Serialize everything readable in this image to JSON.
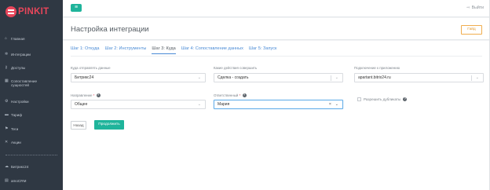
{
  "app": {
    "logo": "PINKIT"
  },
  "sidebar": {
    "items": [
      {
        "label": "Главная",
        "icon": "home-icon",
        "glyph": "⌂"
      },
      {
        "label": "Интеграции",
        "icon": "integrations-icon",
        "glyph": "✲"
      },
      {
        "label": "Доступы",
        "icon": "key-icon",
        "glyph": "⚷"
      },
      {
        "label": "Сопоставление сущностей",
        "icon": "mapping-icon",
        "glyph": "▦"
      },
      {
        "label": "Настройки",
        "icon": "settings-icon",
        "glyph": "⚙"
      },
      {
        "label": "Тариф",
        "icon": "tariff-icon",
        "glyph": "▬"
      },
      {
        "label": "Теги",
        "icon": "tags-icon",
        "glyph": "⚑"
      },
      {
        "label": "Акции",
        "icon": "promo-icon",
        "glyph": "✕"
      }
    ],
    "portals": [
      {
        "label": "Битрикс24",
        "icon": "bitrix24-icon",
        "glyph": "☁"
      },
      {
        "label": "amoCRM",
        "icon": "amocrm-icon",
        "glyph": "▤"
      }
    ]
  },
  "topbar": {
    "menu_glyph": "≡",
    "logout_label": "Выйти",
    "logout_glyph": "⇨"
  },
  "header": {
    "title": "Настройка интеграции",
    "guide_label": "Гайд"
  },
  "tabs": [
    {
      "label": "Шаг 1: Откуда",
      "active": false
    },
    {
      "label": "Шаг 2: Инструменты",
      "active": false
    },
    {
      "label": "Шаг 3: Куда",
      "active": true
    },
    {
      "label": "Шаг 4: Сопоставление данных",
      "active": false
    },
    {
      "label": "Шаг 5: Запуск",
      "active": false
    }
  ],
  "form": {
    "destination": {
      "label": "Куда отправлять данные",
      "value": "Битрикс24"
    },
    "action": {
      "label": "Какие действия совершить",
      "value": "Сделка - создать"
    },
    "connection": {
      "label": "Подключение к приложению",
      "value": "apartant.bitrix24.ru"
    },
    "direction": {
      "label": "Направление",
      "required_mark": "*",
      "value": "Общее"
    },
    "responsible": {
      "label": "Ответственный",
      "required_mark": "*",
      "value": "Мария"
    },
    "duplicates": {
      "label": "Разрешить дубликаты",
      "checked": false
    }
  },
  "actions": {
    "back_label": "Назад",
    "next_label": "Продолжить"
  },
  "colors": {
    "accent": "#1fb49b",
    "sidebar_bg": "#2f3843",
    "logo": "#e8465b",
    "link": "#4a8bd6",
    "guide": "#f0ad4e"
  }
}
